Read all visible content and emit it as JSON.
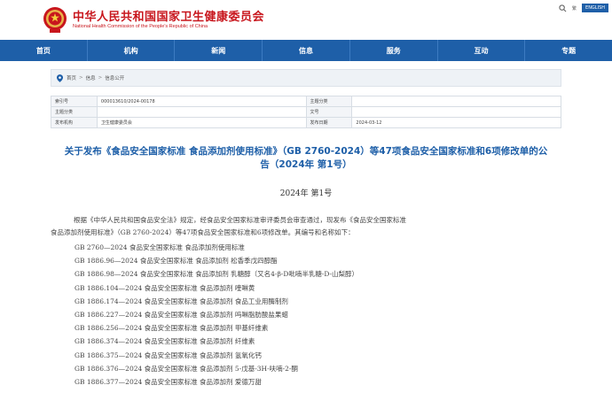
{
  "header": {
    "title": "中华人民共和国国家卫生健康委员会",
    "subtitle": "National Health Commission of the People's Republic of China",
    "tools": [
      "繁",
      "ENGLISH"
    ],
    "brand_color": "#c8161d"
  },
  "nav": {
    "items": [
      "首页",
      "机构",
      "新闻",
      "信息",
      "服务",
      "互动",
      "专题"
    ],
    "color": "#1e5fa8"
  },
  "breadcrumb": {
    "items": [
      "首页",
      "信息",
      "信息公开"
    ],
    "separator": ">"
  },
  "meta": {
    "rows": [
      {
        "k1": "索引号",
        "v1": "000013610/2024-00178",
        "k2": "主题分类",
        "v2": ""
      },
      {
        "k1": "主题分类",
        "v1": "",
        "k2": "文号",
        "v2": ""
      },
      {
        "k1": "发布机构",
        "v1": "卫生健康委员会",
        "k2": "发布日期",
        "v2": "2024-03-12"
      }
    ]
  },
  "article": {
    "title_line1": "关于发布《食品安全国家标准 食品添加剂使用标准》（GB 2760-2024）等47项食品安全国家标准和6项修改单的公",
    "title_line2": "告（2024年 第1号）",
    "issue": "2024年  第1号",
    "intro_line1": "根据《中华人民共和国食品安全法》规定，经食品安全国家标准审评委员会审查通过，现发布《食品安全国家标准",
    "intro_line2": "食品添加剂使用标准》（GB 2760-2024）等47项食品安全国家标准和6项修改单。其编号和名称如下：",
    "standards": [
      "GB 2760—2024  食品安全国家标准  食品添加剂使用标准",
      "GB 1886.96—2024  食品安全国家标准  食品添加剂  松香季戊四醇酯",
      "GB 1886.98—2024  食品安全国家标准  食品添加剂  乳糖醇（又名4-β-D吡喃半乳糖-D-山梨醇）",
      "GB 1886.104—2024  食品安全国家标准  食品添加剂  喹啉黄",
      "GB 1886.174—2024  食品安全国家标准  食品添加剂  食品工业用酶制剂",
      "GB 1886.227—2024  食品安全国家标准  食品添加剂  吗啉脂肪酸盐果蜡",
      "GB 1886.256—2024  食品安全国家标准  食品添加剂  甲基纤维素",
      "GB 1886.374—2024  食品安全国家标准  食品添加剂  纤维素",
      "GB 1886.375—2024  食品安全国家标准  食品添加剂  氢氧化钙",
      "GB 1886.376—2024  食品安全国家标准  食品添加剂  5-戊基-3H-呋喃-2-酮",
      "GB 1886.377—2024  食品安全国家标准  食品添加剂  爱德万甜"
    ]
  }
}
